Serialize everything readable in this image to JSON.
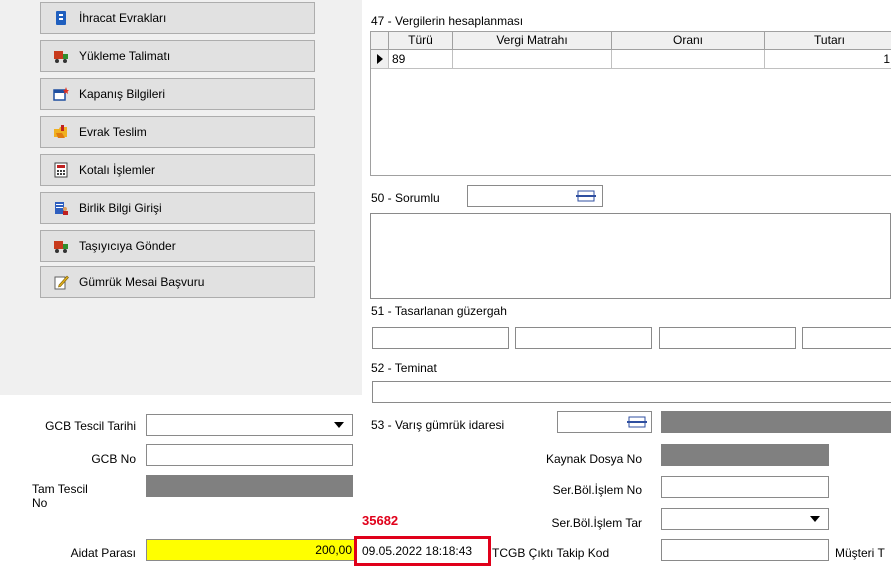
{
  "sidebar": {
    "items": [
      {
        "label": "İhracat Evrakları",
        "icon": "document-blue-icon"
      },
      {
        "label": "Yükleme Talimatı",
        "icon": "truck-icon"
      },
      {
        "label": "Kapanış Bilgileri",
        "icon": "window-star-icon"
      },
      {
        "label": "Evrak Teslim",
        "icon": "folder-hand-icon"
      },
      {
        "label": "Kotalı İşlemler",
        "icon": "calculator-icon"
      },
      {
        "label": "Birlik Bilgi Girişi",
        "icon": "server-person-icon"
      },
      {
        "label": "Taşıyıcıya Gönder",
        "icon": "truck-icon"
      },
      {
        "label": "Gümrük Mesai Başvuru",
        "icon": "pencil-note-icon"
      }
    ]
  },
  "tax": {
    "title": "47 - Vergilerin hesaplanması",
    "columns": [
      "Türü",
      "Vergi Matrahı",
      "Oranı",
      "Tutarı"
    ],
    "rows": [
      {
        "turu": "89",
        "matrah": "",
        "oran": "",
        "tutar": "1"
      }
    ]
  },
  "sorumlu": {
    "label": "50 - Sorumlu"
  },
  "guzergah": {
    "label": "51 - Tasarlanan güzergah"
  },
  "teminat": {
    "label": "52 - Teminat"
  },
  "varis": {
    "label": "53 - Varış gümrük idaresi"
  },
  "form": {
    "gcb_tescil_tarihi": "GCB Tescil Tarihi",
    "gcb_no": "GCB No",
    "tam_tescil": "Tam Tescil",
    "tam_tescil_2": "No",
    "aidat": "Aidat Parası",
    "aidat_value": "200,00",
    "kaynak": "Kaynak Dosya No",
    "ser_bol_islem_no": "Ser.Böl.İşlem No",
    "ser_bol_islem_tar": "Ser.Böl.İşlem Tar",
    "tcgb": "TCGB Çıktı Takip Kod",
    "musteri": "Müşteri T"
  },
  "annotation": {
    "number": "35682",
    "datetime": "09.05.2022 18:18:43"
  },
  "colors": {
    "highlight": "#ffff00",
    "annotation_red": "#e0001a",
    "readonly_gray": "#808080"
  }
}
